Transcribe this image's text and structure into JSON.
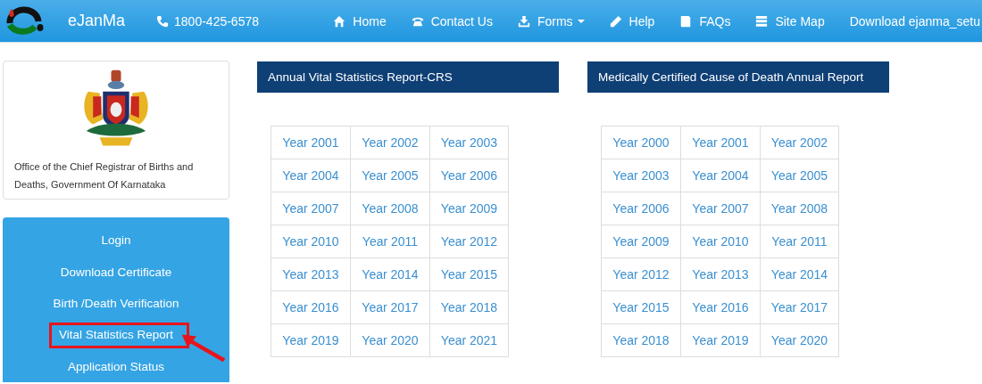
{
  "navbar": {
    "brand": "eJanMa",
    "phone": "1800-425-6578",
    "links": [
      {
        "label": "Home",
        "kind": "home",
        "dropdown": false
      },
      {
        "label": "Contact Us",
        "kind": "contact",
        "dropdown": false
      },
      {
        "label": "Forms",
        "kind": "forms",
        "dropdown": true
      },
      {
        "label": "Help",
        "kind": "help",
        "dropdown": false
      },
      {
        "label": "FAQs",
        "kind": "faqs",
        "dropdown": false
      },
      {
        "label": "Site Map",
        "kind": "sitemap",
        "dropdown": false
      },
      {
        "label": "Download ejanma_setu",
        "kind": "text",
        "dropdown": false
      }
    ]
  },
  "sidebar": {
    "office": "Office of the Chief Registrar of Births and Deaths, Government Of Karnataka",
    "menu": [
      {
        "label": "Login",
        "highlighted": false
      },
      {
        "label": "Download Certificate",
        "highlighted": false
      },
      {
        "label": "Birth /Death Verification",
        "highlighted": false
      },
      {
        "label": "Vital Statistics Report",
        "highlighted": true
      },
      {
        "label": "Application Status",
        "highlighted": false
      }
    ]
  },
  "panels": [
    {
      "title": "Annual Vital Statistics Report-CRS",
      "years": [
        "Year 2001",
        "Year 2002",
        "Year 2003",
        "Year 2004",
        "Year 2005",
        "Year 2006",
        "Year 2007",
        "Year 2008",
        "Year 2009",
        "Year 2010",
        "Year 2011",
        "Year 2012",
        "Year 2013",
        "Year 2014",
        "Year 2015",
        "Year 2016",
        "Year 2017",
        "Year 2018",
        "Year 2019",
        "Year 2020",
        "Year 2021"
      ]
    },
    {
      "title": "Medically Certified Cause of Death Annual Report",
      "years": [
        "Year 2000",
        "Year 2001",
        "Year 2002",
        "Year 2003",
        "Year 2004",
        "Year 2005",
        "Year 2006",
        "Year 2007",
        "Year 2008",
        "Year 2009",
        "Year 2010",
        "Year 2011",
        "Year 2012",
        "Year 2013",
        "Year 2014",
        "Year 2015",
        "Year 2016",
        "Year 2017",
        "Year 2018",
        "Year 2019",
        "Year 2020"
      ]
    }
  ]
}
